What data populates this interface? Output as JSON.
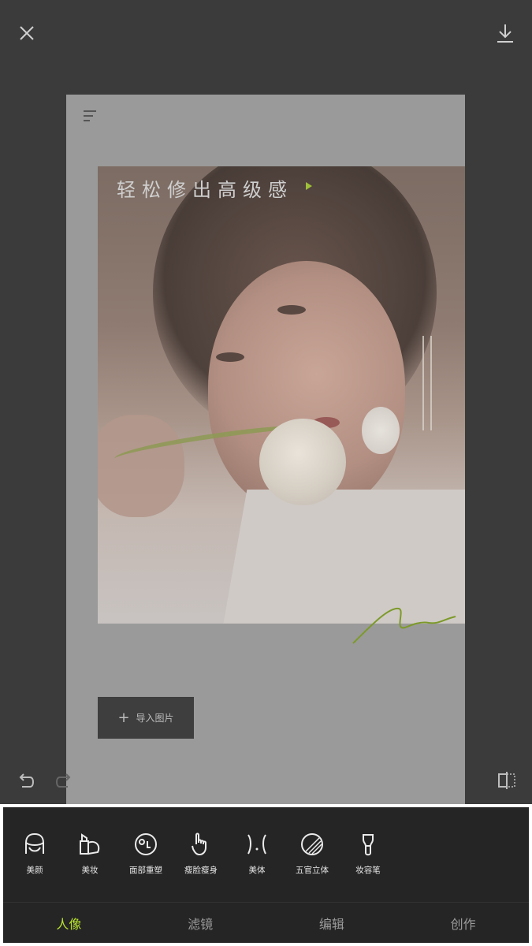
{
  "topbar": {
    "close_icon": "close-icon",
    "download_icon": "download-icon"
  },
  "canvas": {
    "menu_icon": "menu-icon",
    "promo_text": "轻松修出高级感",
    "signature_icon": "signature-icon",
    "import_button_label": "导入图片"
  },
  "controls": {
    "undo_icon": "undo-icon",
    "redo_icon": "redo-icon",
    "compare_icon": "compare-icon"
  },
  "tools": [
    {
      "label": "美颜",
      "icon": "face-icon"
    },
    {
      "label": "美妆",
      "icon": "makeup-icon"
    },
    {
      "label": "面部重塑",
      "icon": "face-reshape-icon"
    },
    {
      "label": "瘦脸瘦身",
      "icon": "slim-icon"
    },
    {
      "label": "美体",
      "icon": "body-icon"
    },
    {
      "label": "五官立体",
      "icon": "contour-icon"
    },
    {
      "label": "妆容笔",
      "icon": "brush-icon"
    }
  ],
  "tabs": [
    {
      "label": "人像",
      "active": true
    },
    {
      "label": "滤镜",
      "active": false
    },
    {
      "label": "编辑",
      "active": false
    },
    {
      "label": "创作",
      "active": false
    }
  ],
  "colors": {
    "accent": "#b8e22f",
    "panel_bg": "#252525",
    "app_bg": "#3b3b3b"
  }
}
